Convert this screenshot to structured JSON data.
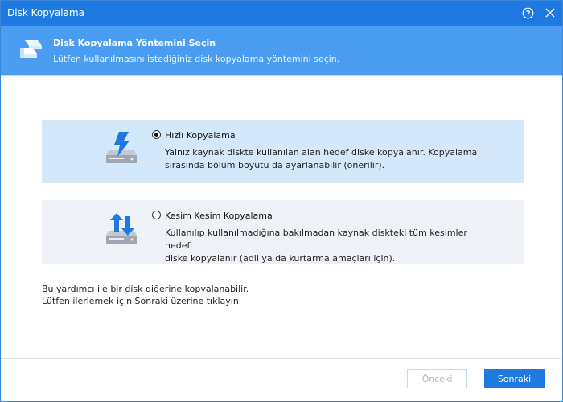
{
  "window": {
    "title": "Disk Kopyalama"
  },
  "titlebar": {
    "help_icon": "help-icon",
    "close_icon": "close-icon"
  },
  "header": {
    "icon": "disk-stack-icon",
    "title": "Disk Kopyalama Yöntemini Seçin",
    "subtitle": "Lütfen kullanılmasını istediğiniz disk kopyalama yöntemini seçin."
  },
  "options": [
    {
      "label": "Hızlı Kopyalama",
      "description_lines": [
        "Yalnız kaynak diskte kullanılan alan hedef diske kopyalanır. Kopyalama",
        "sırasında bölüm boyutu da ayarlanabilir (önerilir)."
      ],
      "selected": true,
      "icon": "lightning-disk-icon"
    },
    {
      "label": "Kesim Kesim Kopyalama",
      "description_lines": [
        "Kullanılıp kullanılmadığına bakılmadan kaynak diskteki tüm kesimler hedef",
        "diske kopyalanır (adli ya da kurtarma amaçları için)."
      ],
      "selected": false,
      "icon": "arrows-disk-icon"
    }
  ],
  "info": {
    "line1": "Bu yardımcı ile bir disk diğerine kopyalanabilir.",
    "line2": "Lütfen ilerlemek için Sonraki üzerine tıklayın."
  },
  "buttons": {
    "prev": "Önceki",
    "next": "Sonraki",
    "prev_enabled": false
  },
  "colors": {
    "titlebar": "#1e7ae0",
    "header": "#4a9df0",
    "selected_option_bg": "#d4e8fb",
    "unselected_option_bg": "#eef2f7",
    "primary_button": "#1e7ae0"
  }
}
